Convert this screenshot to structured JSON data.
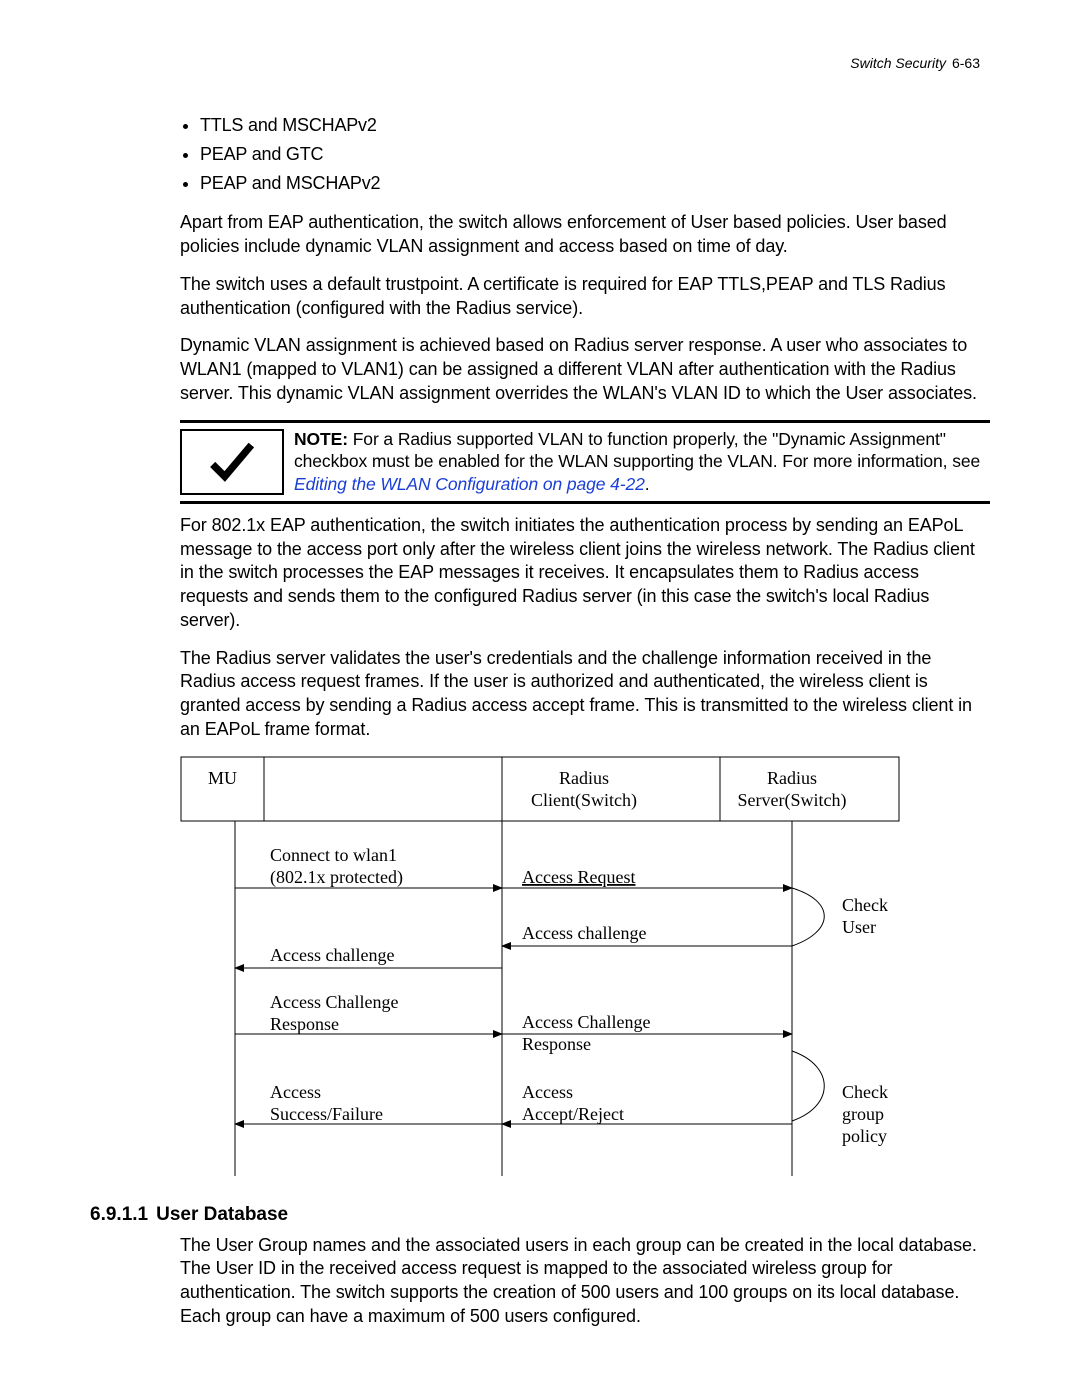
{
  "header": {
    "title": "Switch Security",
    "page": "6-63"
  },
  "bullets": [
    "TTLS and MSCHAPv2",
    "PEAP and GTC",
    "PEAP and MSCHAPv2"
  ],
  "para1": "Apart from EAP authentication, the switch allows enforcement of User based policies. User based policies include dynamic VLAN assignment and access based on time of day.",
  "para2": "The switch uses a default trustpoint. A certificate is required for EAP TTLS,PEAP and TLS Radius authentication (configured with the Radius service).",
  "para3": "Dynamic VLAN assignment is achieved based on Radius server response. A user who associates to WLAN1 (mapped to VLAN1) can be assigned a different VLAN after authentication with the Radius server. This dynamic VLAN assignment overrides the WLAN's VLAN ID to which the User associates.",
  "note": {
    "label": "NOTE:",
    "text_a": " For a Radius supported VLAN to function properly, the \"Dynamic Assignment\" checkbox must be enabled for the WLAN supporting the VLAN. For more information, see ",
    "link": "Editing the WLAN Configuration on page 4-22",
    "text_b": "."
  },
  "para4": "For 802.1x EAP authentication, the switch initiates the authentication process by sending an EAPoL message to the access port only after the wireless client joins the wireless network. The Radius client in the switch processes the EAP messages it receives. It encapsulates them to Radius access requests and sends them to the configured Radius server (in this case the switch's local Radius server).",
  "para5": "The Radius server validates the user's credentials and the challenge information received in the Radius access request frames. If the user is authorized and authenticated, the wireless client is granted access by sending a Radius access accept frame. This is transmitted to the wireless client in an EAPoL frame format.",
  "diagram": {
    "col1": "MU",
    "col2a": "Radius",
    "col2b": "Client(Switch)",
    "col3a": "Radius",
    "col3b": "Server(Switch)",
    "msg1a": "Connect to wlan1",
    "msg1b": "(802.1x protected)",
    "msg2": "Access Request",
    "msg3": "Access challenge",
    "msg4": "Access challenge",
    "msg5": "Access Challenge",
    "msg5b": "Response",
    "msg6": "Access Challenge",
    "msg6b": "Response",
    "msg7": "Access",
    "msg7b": "Success/Failure",
    "msg8": "Access",
    "msg8b": "Accept/Reject",
    "cb1a": "Check",
    "cb1b": "User",
    "cb2a": "Check",
    "cb2b": "group",
    "cb2c": "policy"
  },
  "section": {
    "num": "6.9.1.1",
    "title": "User Database"
  },
  "para6": "The User Group names and the associated users in each group can be created in the local database. The User ID in the received access request is mapped to the associated wireless group for authentication. The switch supports the creation of 500 users and 100 groups on its local database. Each group can have a maximum of 500 users configured."
}
